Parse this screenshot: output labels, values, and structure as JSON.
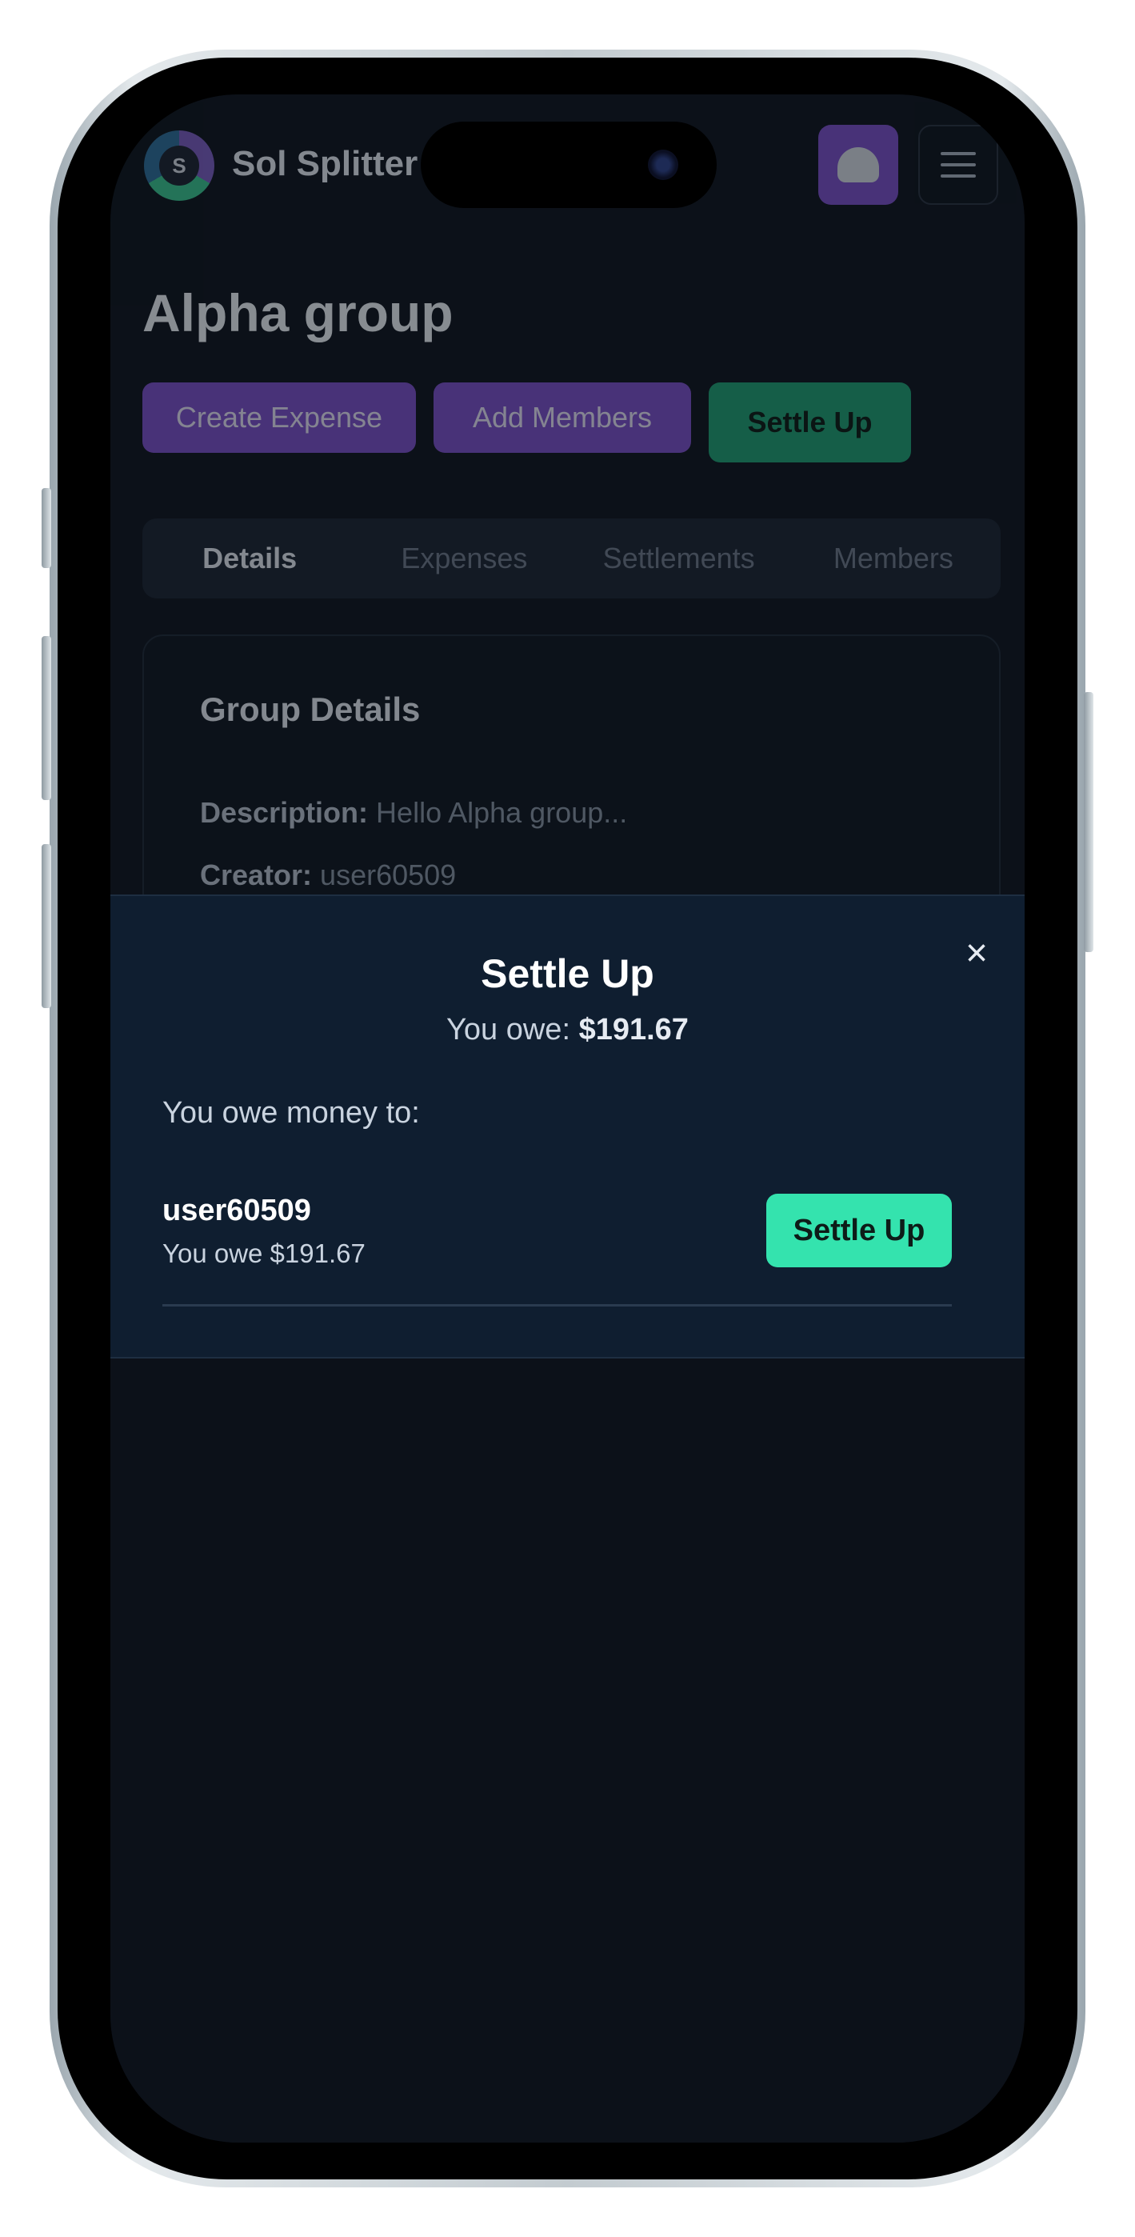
{
  "header": {
    "brand": "Sol Splitter",
    "logo_glyph": "S"
  },
  "group": {
    "title": "Alpha group",
    "actions": {
      "create_expense": "Create Expense",
      "add_members": "Add Members",
      "settle_up": "Settle Up"
    },
    "tabs": [
      "Details",
      "Expenses",
      "Settlements",
      "Members"
    ],
    "active_tab": "Details",
    "details": {
      "title": "Group Details",
      "description_label": "Description:",
      "description_value": "Hello Alpha group...",
      "creator_label": "Creator:",
      "creator_value": "user60509"
    }
  },
  "modal": {
    "title": "Settle Up",
    "you_owe_label": "You owe:",
    "you_owe_amount": "$191.67",
    "owe_to_label": "You owe money to:",
    "debts": [
      {
        "user": "user60509",
        "detail": "You owe $191.67",
        "button": "Settle Up"
      }
    ],
    "close_glyph": "×"
  },
  "icons": {
    "logo": "sol-splitter-logo-icon",
    "avatar": "ghost-avatar-icon",
    "menu": "hamburger-menu-icon",
    "close": "close-icon"
  },
  "colors": {
    "accent_purple": "#7b50c8",
    "settle_green": "#34e3ae",
    "modal_bg": "#0f1e30"
  }
}
